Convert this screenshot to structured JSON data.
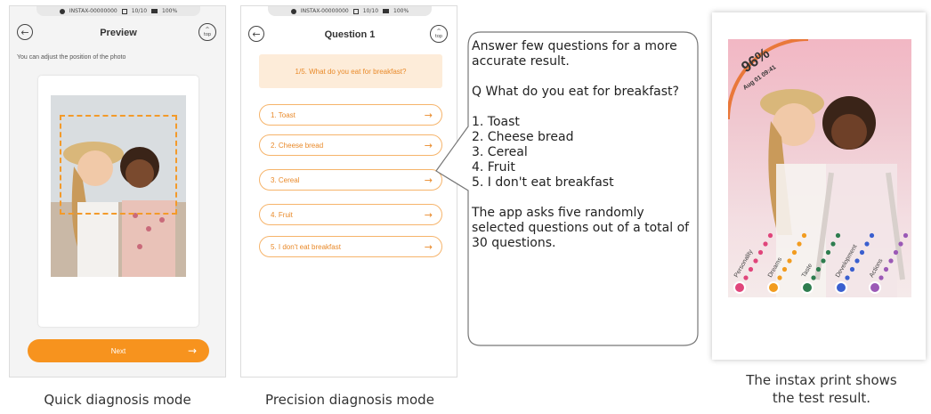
{
  "phone1": {
    "status": {
      "device": "INSTAX-00000000",
      "film": "10/10",
      "battery": "100%"
    },
    "title": "Preview",
    "top_icon_label": "top",
    "hint": "You can adjust the position of the photo",
    "next_label": "Next",
    "next_arrow": "→"
  },
  "phone2": {
    "status": {
      "device": "INSTAX-00000000",
      "film": "10/10",
      "battery": "100%"
    },
    "title": "Question 1",
    "top_icon_label": "top",
    "question": "1/5. What do you eat for breakfast?",
    "answers": [
      {
        "label": "1. Toast"
      },
      {
        "label": "2. Cheese bread"
      },
      {
        "label": "3. Cereal"
      },
      {
        "label": "4. Fruit"
      },
      {
        "label": "5. I don't eat breakfast"
      }
    ],
    "arrow": "→"
  },
  "callout": {
    "intro": "Answer few questions for a more accurate result.",
    "question": "Q What do you eat for breakfast?",
    "options": [
      "1. Toast",
      "2. Cheese bread",
      "3. Cereal",
      "4. Fruit",
      "5. I don't eat breakfast"
    ],
    "outro": "The app asks five randomly selected questions out of a total of 30 questions."
  },
  "print": {
    "score": "96%",
    "date": "Aug 01 09:41",
    "categories": [
      {
        "label": "Personality",
        "color": "#e0457b"
      },
      {
        "label": "Dreams",
        "color": "#f29c1f"
      },
      {
        "label": "Taste",
        "color": "#2e7d4f"
      },
      {
        "label": "Development",
        "color": "#3a5fcf"
      },
      {
        "label": "Actions",
        "color": "#9b59b6"
      }
    ]
  },
  "captions": {
    "quick": "Quick diagnosis mode",
    "precision": "Precision diagnosis mode",
    "print_line1": "The instax print shows",
    "print_line2": "the test result."
  },
  "colors": {
    "accent": "#f7931e",
    "accent_light": "#fdecd9"
  }
}
